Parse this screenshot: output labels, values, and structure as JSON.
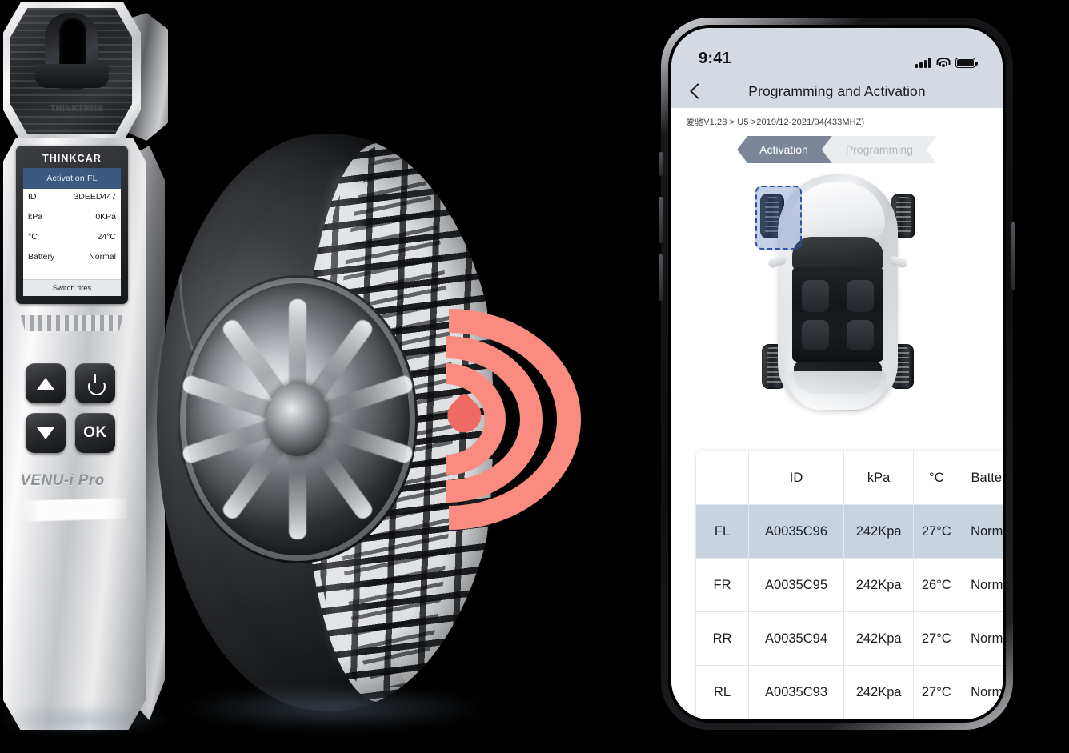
{
  "device": {
    "top_emboss": "THINKTPMS",
    "brand": "THINKCAR",
    "model": "VENU-i Pro",
    "screen": {
      "title": "Activation FL",
      "rows": [
        {
          "label": "ID",
          "value": "3DEED447"
        },
        {
          "label": "kPa",
          "value": "0KPa"
        },
        {
          "label": "°C",
          "value": "24°C"
        },
        {
          "label": "Battery",
          "value": "Normal"
        }
      ],
      "footer_button": "Switch tires"
    },
    "keys": {
      "up": "up-arrow",
      "power": "power",
      "down": "down-arrow",
      "ok": "OK"
    }
  },
  "signal": {
    "icon": "rf-signal-waves",
    "color": "#fa8b80"
  },
  "phone": {
    "status_bar": {
      "time": "9:41",
      "icons": [
        "cellular-signal",
        "wifi",
        "battery"
      ]
    },
    "nav": {
      "back_icon": "chevron-left",
      "title": "Programming and Activation"
    },
    "breadcrumb": "爱驰V1.23 > U5 >2019/12-2021/04(433MHZ)",
    "tabs": [
      {
        "label": "Activation",
        "active": true
      },
      {
        "label": "Programming",
        "active": false
      }
    ],
    "car_diagram": {
      "selected_wheel": "FL",
      "selection_color": "#2a52a8"
    },
    "table": {
      "headers": [
        "",
        "ID",
        "kPa",
        "°C",
        "Battery"
      ],
      "rows": [
        {
          "position": "FL",
          "id": "A0035C96",
          "kpa": "242Kpa",
          "temp": "27°C",
          "battery": "Normal",
          "selected": true
        },
        {
          "position": "FR",
          "id": "A0035C95",
          "kpa": "242Kpa",
          "temp": "26°C",
          "battery": "Normal",
          "selected": false
        },
        {
          "position": "RR",
          "id": "A0035C94",
          "kpa": "242Kpa",
          "temp": "27°C",
          "battery": "Normal",
          "selected": false
        },
        {
          "position": "RL",
          "id": "A0035C93",
          "kpa": "242Kpa",
          "temp": "27°C",
          "battery": "Normal",
          "selected": false
        }
      ],
      "selected_row_color": "#c9d2df"
    }
  }
}
